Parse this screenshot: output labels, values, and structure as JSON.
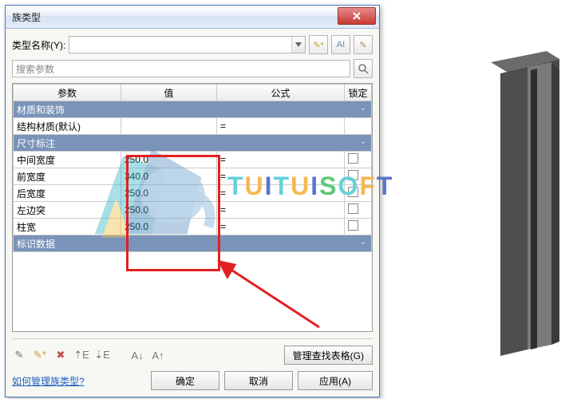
{
  "dialog": {
    "title": "族类型",
    "type_label": "类型名称(Y):",
    "type_value": "",
    "search_placeholder": "搜索参数",
    "headers": {
      "param": "参数",
      "value": "值",
      "formula": "公式",
      "lock": "锁定"
    },
    "groups": [
      {
        "name": "材质和装饰",
        "rows": [
          {
            "param": "结构材质(默认)",
            "value": "",
            "formula": "=",
            "lockable": false
          }
        ]
      },
      {
        "name": "尺寸标注",
        "rows": [
          {
            "param": "中间宽度",
            "value": "250.0",
            "formula": "=",
            "lockable": true
          },
          {
            "param": "前宽度",
            "value": "340.0",
            "formula": "=",
            "lockable": true
          },
          {
            "param": "后宽度",
            "value": "250.0",
            "formula": "=",
            "lockable": true
          },
          {
            "param": "左边突",
            "value": "250.0",
            "formula": "=",
            "lockable": true
          },
          {
            "param": "柱宽",
            "value": "250.0",
            "formula": "=",
            "lockable": true
          }
        ]
      },
      {
        "name": "标识数据",
        "rows": []
      }
    ],
    "manage_lookup": "管理查找表格(G)",
    "help": "如何管理族类型?",
    "ok": "确定",
    "cancel": "取消",
    "apply": "应用(A)"
  },
  "icons": {
    "new_type": "new-type-icon",
    "rename_type": "rename-type-icon",
    "delete_type": "delete-type-icon",
    "search": "search-icon",
    "tools": [
      "pencil-icon",
      "new-param-icon",
      "delete-param-icon",
      "move-up-icon",
      "move-down-icon",
      "sort-asc-icon",
      "sort-desc-icon"
    ]
  },
  "brand": {
    "t": "T",
    "u": "U",
    "i": "I",
    "s": "S",
    "o": "O",
    "f": "F"
  }
}
